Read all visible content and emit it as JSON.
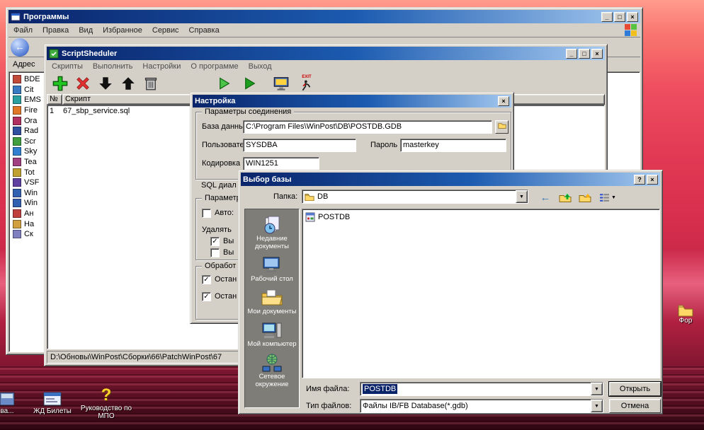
{
  "colors": {
    "titlebar_start": "#0a246a",
    "titlebar_end": "#a6caf0",
    "chrome": "#d4d0c8",
    "selection": "#0a246a",
    "desktop_red": "#d92f4e"
  },
  "icons": {
    "close": "×",
    "minimize": "_",
    "maximize": "□",
    "help": "?",
    "dropdown": "▼",
    "check": "✓",
    "back": "←"
  },
  "desktop": {
    "partial_label": "ва...",
    "zd_label": "ЖД Билеты",
    "guide_label": "Руководство по МПО",
    "guide_glyph": "?",
    "for_label": "Фор"
  },
  "programs": {
    "title": "Программы",
    "menu": [
      "Файл",
      "Правка",
      "Вид",
      "Избранное",
      "Сервис",
      "Справка"
    ],
    "address_label": "Адрес",
    "sidebar": [
      "BDE",
      "Cit",
      "EMS",
      "Fire",
      "Ora",
      "Rad",
      "Scr",
      "Sky",
      "Tea",
      "Tot",
      "VSF",
      "Win",
      "Win",
      "Ан",
      "На",
      "Ск"
    ]
  },
  "ss": {
    "title": "ScriptSheduler",
    "menu": [
      "Скрипты",
      "Выполнить",
      "Настройки",
      "О программе",
      "Выход"
    ],
    "exit_label": "EXIT",
    "columns": [
      "№",
      "Скрипт"
    ],
    "row": {
      "num": "1",
      "script": "67_sbp_service.sql"
    },
    "status": "D:\\Обновы\\WinPost\\Сборки\\66\\PatchWinPost\\67"
  },
  "nastroyka": {
    "title": "Настройка",
    "group1_legend": "Параметры соединения",
    "db_label": "База данных",
    "db_value": "C:\\Program Files\\WinPost\\DB\\POSTDB.GDB",
    "user_label": "Пользователь",
    "user_value": "SYSDBA",
    "pass_label": "Пароль",
    "pass_value": "masterkey",
    "enc_label": "Кодировка",
    "enc_value": "WIN1251",
    "sql_label": "SQL диал",
    "group2_legend": "Параметр",
    "auto_label": "Авто:",
    "delete_label": "Удалять",
    "cb1_label": "Вы",
    "cb2_label": "Вы",
    "group3_legend": "Обработ",
    "p1_label": "Остан",
    "p2_label": "Остан",
    "checks": {
      "auto": "",
      "cb1": "✓",
      "cb2": "",
      "p1": "✓",
      "p2": "✓"
    }
  },
  "fdlg": {
    "title": "Выбор базы",
    "folder_label": "Папка:",
    "folder_value": "DB",
    "places": [
      "Недавние документы",
      "Рабочий стол",
      "Мои документы",
      "Мой компьютер",
      "Сетевое окружение"
    ],
    "file_item": "POSTDB",
    "filename_label": "Имя файла:",
    "filename_value": "POSTDB",
    "filetype_label": "Тип файлов:",
    "filetype_value": "Файлы IB/FB Database(*.gdb)",
    "open_button": "Открыть",
    "cancel_button": "Отмена"
  }
}
